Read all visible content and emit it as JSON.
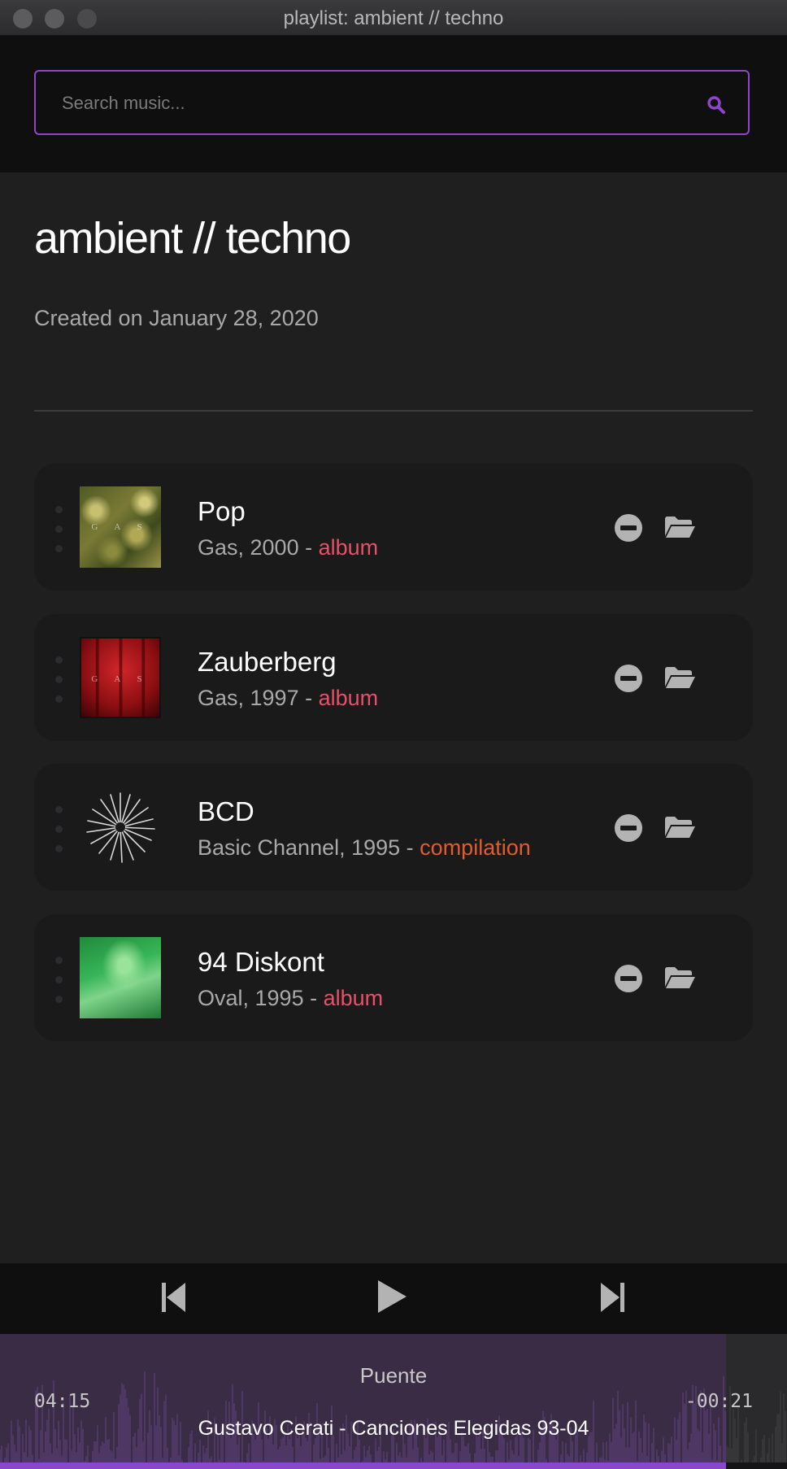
{
  "window": {
    "title": "playlist: ambient // techno"
  },
  "search": {
    "placeholder": "Search music..."
  },
  "playlist": {
    "title": "ambient // techno",
    "created": "Created on January 28, 2020",
    "items": [
      {
        "name": "Pop",
        "artist_year": "Gas, 2000 - ",
        "type": "album",
        "cover": "gas-pop-cover",
        "cover_letters": "G A S"
      },
      {
        "name": "Zauberberg",
        "artist_year": "Gas, 1997 - ",
        "type": "album",
        "cover": "gas-zauberberg-cover",
        "cover_letters": "G A S"
      },
      {
        "name": "BCD",
        "artist_year": "Basic Channel, 1995 - ",
        "type": "compilation",
        "cover": "basic-channel-bcd-cover"
      },
      {
        "name": "94 Diskont",
        "artist_year": "Oval, 1995 - ",
        "type": "album",
        "cover": "oval-94-diskont-cover"
      }
    ]
  },
  "player": {
    "track": "Puente",
    "artist_album": "Gustavo Cerati - Canciones Elegidas 93-04",
    "elapsed": "04:15",
    "remaining": "-00:21",
    "progress": 0.923
  },
  "colors": {
    "accent": "#8f44c9",
    "album_type": "#ea4f69",
    "compilation_type": "#e15c2c",
    "icon_gray": "#b3b3b3"
  },
  "icons": {
    "search": "search-icon",
    "remove": "minus-circle-icon",
    "open": "folder-open-icon",
    "prev": "skip-previous-icon",
    "play": "play-icon",
    "next": "skip-next-icon",
    "drag": "drag-handle-icon"
  }
}
